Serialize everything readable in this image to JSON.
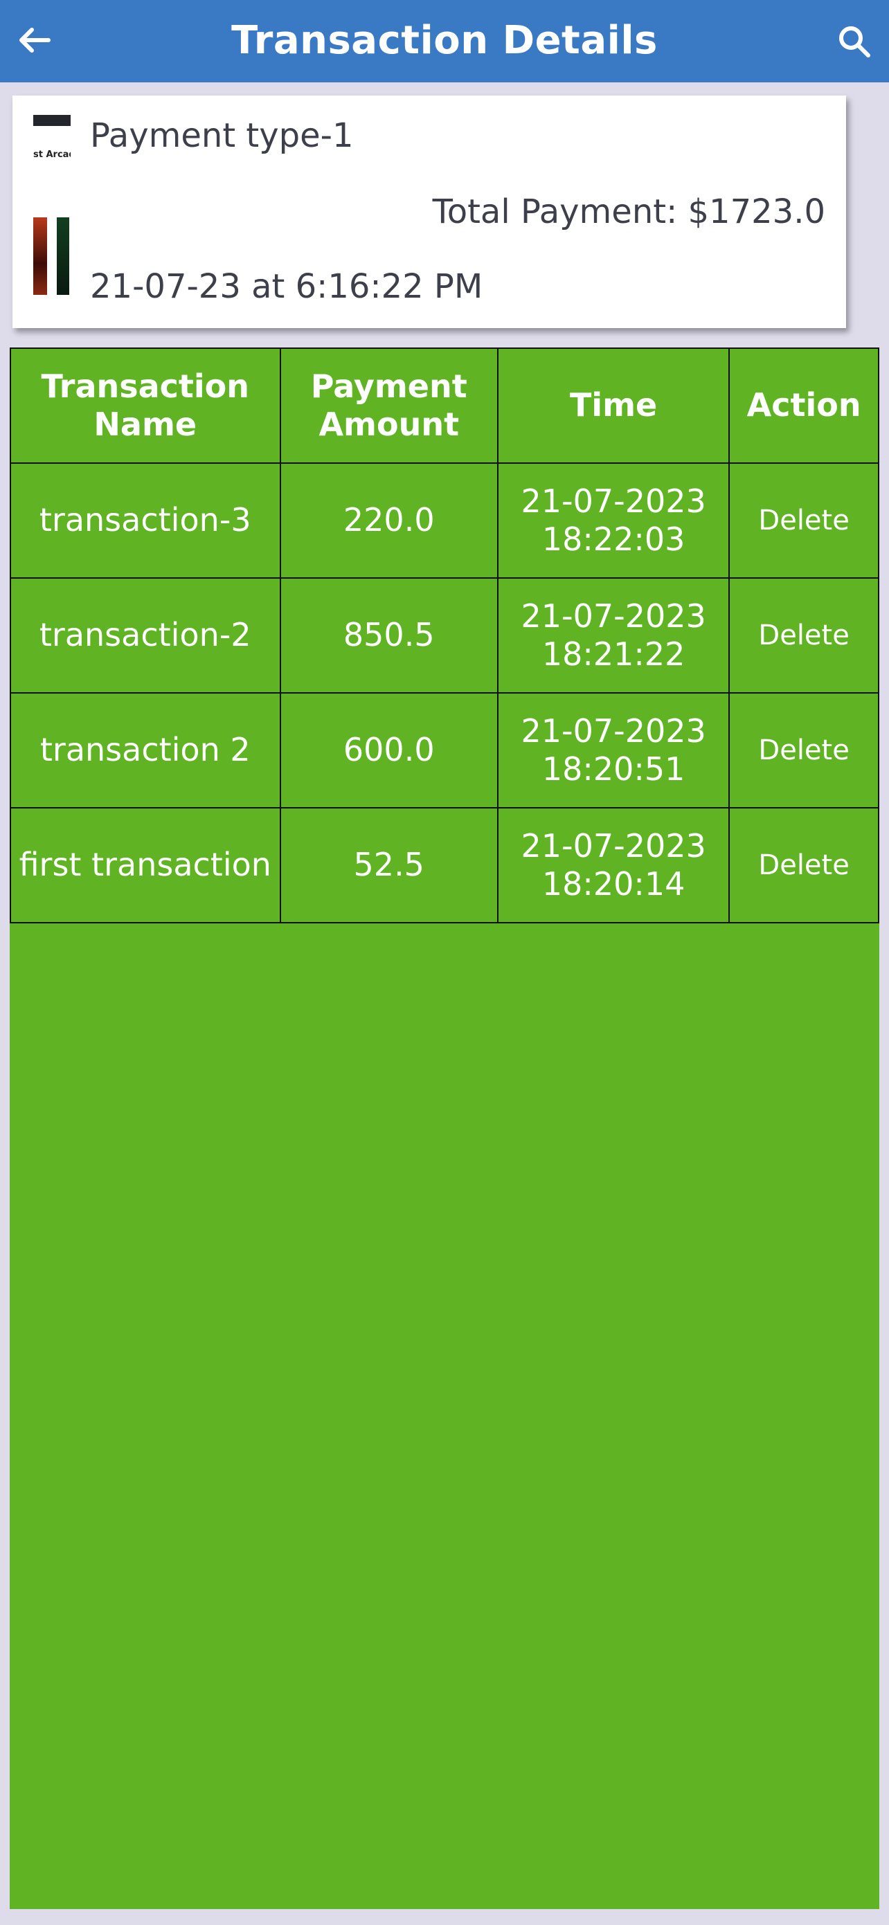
{
  "appbar": {
    "title": "Transaction Details",
    "back_icon": "arrow-left-icon",
    "search_icon": "search-icon"
  },
  "summary": {
    "thumbnail_text": "st Arcadia",
    "payment_type": "Payment type-1",
    "total_payment": "Total Payment: $1723.0",
    "date": "21-07-23 at 6:16:22 PM"
  },
  "table": {
    "headers": [
      "Transaction Name",
      "Payment Amount",
      "Time",
      "Action"
    ],
    "rows": [
      {
        "name": "transaction-3",
        "amount": "220.0",
        "date": "21-07-2023",
        "time": "18:22:03",
        "action": "Delete"
      },
      {
        "name": "transaction-2",
        "amount": "850.5",
        "date": "21-07-2023",
        "time": "18:21:22",
        "action": "Delete"
      },
      {
        "name": "transaction 2",
        "amount": "600.0",
        "date": "21-07-2023",
        "time": "18:20:51",
        "action": "Delete"
      },
      {
        "name": "first transaction",
        "amount": "52.5",
        "date": "21-07-2023",
        "time": "18:20:14",
        "action": "Delete"
      }
    ]
  },
  "colors": {
    "appbar": "#3a79c4",
    "table_background": "#60b424",
    "page_background": "#dedbea"
  }
}
